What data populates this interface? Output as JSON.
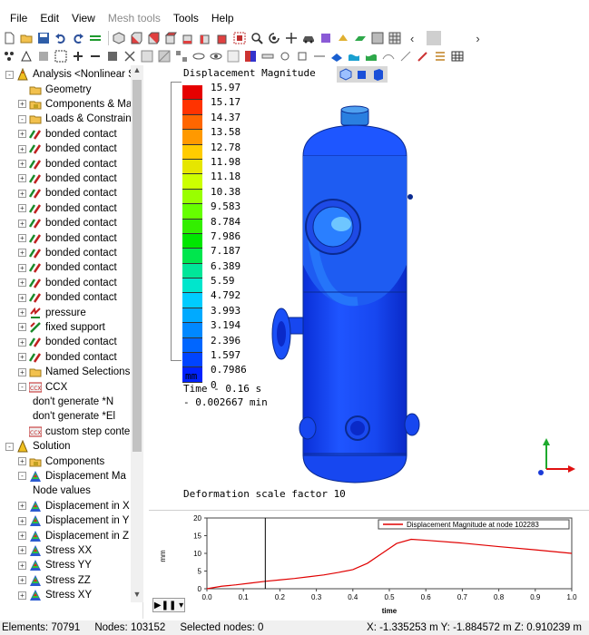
{
  "menu": [
    "File",
    "Edit",
    "View",
    "Mesh tools",
    "Tools",
    "Help"
  ],
  "menu_disabled": [
    false,
    false,
    false,
    true,
    false,
    false
  ],
  "tree": {
    "rows": [
      {
        "label": "Analysis <Nonlinear S",
        "indent": 0,
        "expander": "-",
        "icon": "analysis"
      },
      {
        "label": "Geometry",
        "indent": 1,
        "expander": "",
        "icon": "folder"
      },
      {
        "label": "Components & Mater",
        "indent": 1,
        "expander": "+",
        "icon": "components"
      },
      {
        "label": "Loads & Constraints",
        "indent": 1,
        "expander": "-",
        "icon": "folder"
      },
      {
        "label": "bonded contact",
        "indent": 2,
        "expander": "+",
        "icon": "contact"
      },
      {
        "label": "bonded contact",
        "indent": 2,
        "expander": "+",
        "icon": "contact"
      },
      {
        "label": "bonded contact",
        "indent": 2,
        "expander": "+",
        "icon": "contact"
      },
      {
        "label": "bonded contact",
        "indent": 2,
        "expander": "+",
        "icon": "contact"
      },
      {
        "label": "bonded contact",
        "indent": 2,
        "expander": "+",
        "icon": "contact"
      },
      {
        "label": "bonded contact",
        "indent": 2,
        "expander": "+",
        "icon": "contact"
      },
      {
        "label": "bonded contact",
        "indent": 2,
        "expander": "+",
        "icon": "contact"
      },
      {
        "label": "bonded contact",
        "indent": 2,
        "expander": "+",
        "icon": "contact"
      },
      {
        "label": "bonded contact",
        "indent": 2,
        "expander": "+",
        "icon": "contact"
      },
      {
        "label": "bonded contact",
        "indent": 2,
        "expander": "+",
        "icon": "contact"
      },
      {
        "label": "bonded contact",
        "indent": 2,
        "expander": "+",
        "icon": "contact"
      },
      {
        "label": "bonded contact",
        "indent": 2,
        "expander": "+",
        "icon": "contact"
      },
      {
        "label": "pressure",
        "indent": 2,
        "expander": "+",
        "icon": "pressure"
      },
      {
        "label": "fixed support",
        "indent": 2,
        "expander": "+",
        "icon": "support"
      },
      {
        "label": "bonded contact",
        "indent": 2,
        "expander": "+",
        "icon": "contact"
      },
      {
        "label": "bonded contact",
        "indent": 2,
        "expander": "+",
        "icon": "contact"
      },
      {
        "label": "Named Selections",
        "indent": 1,
        "expander": "+",
        "icon": "folder"
      },
      {
        "label": "CCX",
        "indent": 1,
        "expander": "-",
        "icon": "ccx"
      },
      {
        "label": "don't generate *N",
        "indent": 3,
        "expander": "",
        "icon": "none"
      },
      {
        "label": "don't generate *El",
        "indent": 3,
        "expander": "",
        "icon": "none"
      },
      {
        "label": "custom step conte",
        "indent": 2,
        "expander": "",
        "icon": "ccx"
      },
      {
        "label": "Solution",
        "indent": 0,
        "expander": "-",
        "icon": "solution"
      },
      {
        "label": "Components",
        "indent": 1,
        "expander": "+",
        "icon": "components"
      },
      {
        "label": "Displacement Ma",
        "indent": 1,
        "expander": "-",
        "icon": "result"
      },
      {
        "label": "Node values",
        "indent": 3,
        "expander": "",
        "icon": "none"
      },
      {
        "label": "Displacement in X",
        "indent": 1,
        "expander": "+",
        "icon": "result"
      },
      {
        "label": "Displacement in Y",
        "indent": 1,
        "expander": "+",
        "icon": "result"
      },
      {
        "label": "Displacement in Z",
        "indent": 1,
        "expander": "+",
        "icon": "result"
      },
      {
        "label": "Stress XX",
        "indent": 1,
        "expander": "+",
        "icon": "result"
      },
      {
        "label": "Stress YY",
        "indent": 1,
        "expander": "+",
        "icon": "result"
      },
      {
        "label": "Stress ZZ",
        "indent": 1,
        "expander": "+",
        "icon": "result"
      },
      {
        "label": "Stress XY",
        "indent": 1,
        "expander": "+",
        "icon": "result"
      }
    ]
  },
  "viewport": {
    "legend_title": "Displacement Magnitude",
    "legend_values": [
      "15.97",
      "15.17",
      "14.37",
      "13.58",
      "12.78",
      "11.98",
      "11.18",
      "10.38",
      "9.583",
      "8.784",
      "7.986",
      "7.187",
      "6.389",
      "5.59",
      "4.792",
      "3.993",
      "3.194",
      "2.396",
      "1.597",
      "0.7986",
      "0"
    ],
    "legend_colors": [
      "#e60000",
      "#ff3300",
      "#ff6600",
      "#ff9900",
      "#ffcc00",
      "#e6e600",
      "#ccff00",
      "#99ff00",
      "#66ff00",
      "#33ee00",
      "#00e600",
      "#00e64d",
      "#00e699",
      "#00e6cc",
      "#00ccff",
      "#00aaff",
      "#0088ff",
      "#0066ff",
      "#0044ff",
      "#0022ff"
    ],
    "unit": "mm",
    "time_line1": "Time - 0.16 s",
    "time_line2": "- 0.002667 min",
    "scale_text": "Deformation scale factor 10"
  },
  "graph": {
    "legend": "Displacement Magnitude at node 102283",
    "ylabel": "mm",
    "xlabel": "time",
    "yticks": [
      "20",
      "15",
      "10",
      "5",
      "0"
    ],
    "xticks": [
      "0.0",
      "0.1",
      "0.2",
      "0.3",
      "0.4",
      "0.5",
      "0.6",
      "0.7",
      "0.8",
      "0.9",
      "1.0"
    ],
    "line_color": "#e00000",
    "cursor_time": 0.16
  },
  "chart_data": {
    "type": "line",
    "title": "",
    "xlabel": "time",
    "ylabel": "mm",
    "xlim": [
      0.0,
      1.0
    ],
    "ylim": [
      0,
      20
    ],
    "series": [
      {
        "name": "Displacement Magnitude at node 102283",
        "x": [
          0.0,
          0.04,
          0.08,
          0.12,
          0.16,
          0.2,
          0.24,
          0.28,
          0.32,
          0.36,
          0.4,
          0.44,
          0.48,
          0.52,
          0.56,
          0.6,
          0.7,
          0.8,
          0.9,
          1.0
        ],
        "values": [
          0.0,
          0.7,
          1.1,
          1.6,
          2.1,
          2.5,
          2.9,
          3.4,
          3.9,
          4.6,
          5.4,
          7.2,
          10.0,
          12.8,
          13.97,
          13.7,
          12.9,
          11.9,
          11.0,
          10.0
        ]
      }
    ]
  },
  "status": {
    "elements": "Elements: 70791",
    "nodes": "Nodes: 103152",
    "selected": "Selected nodes: 0",
    "coords": "X: -1.335253 m Y: -1.884572 m Z: 0.910239 m"
  }
}
